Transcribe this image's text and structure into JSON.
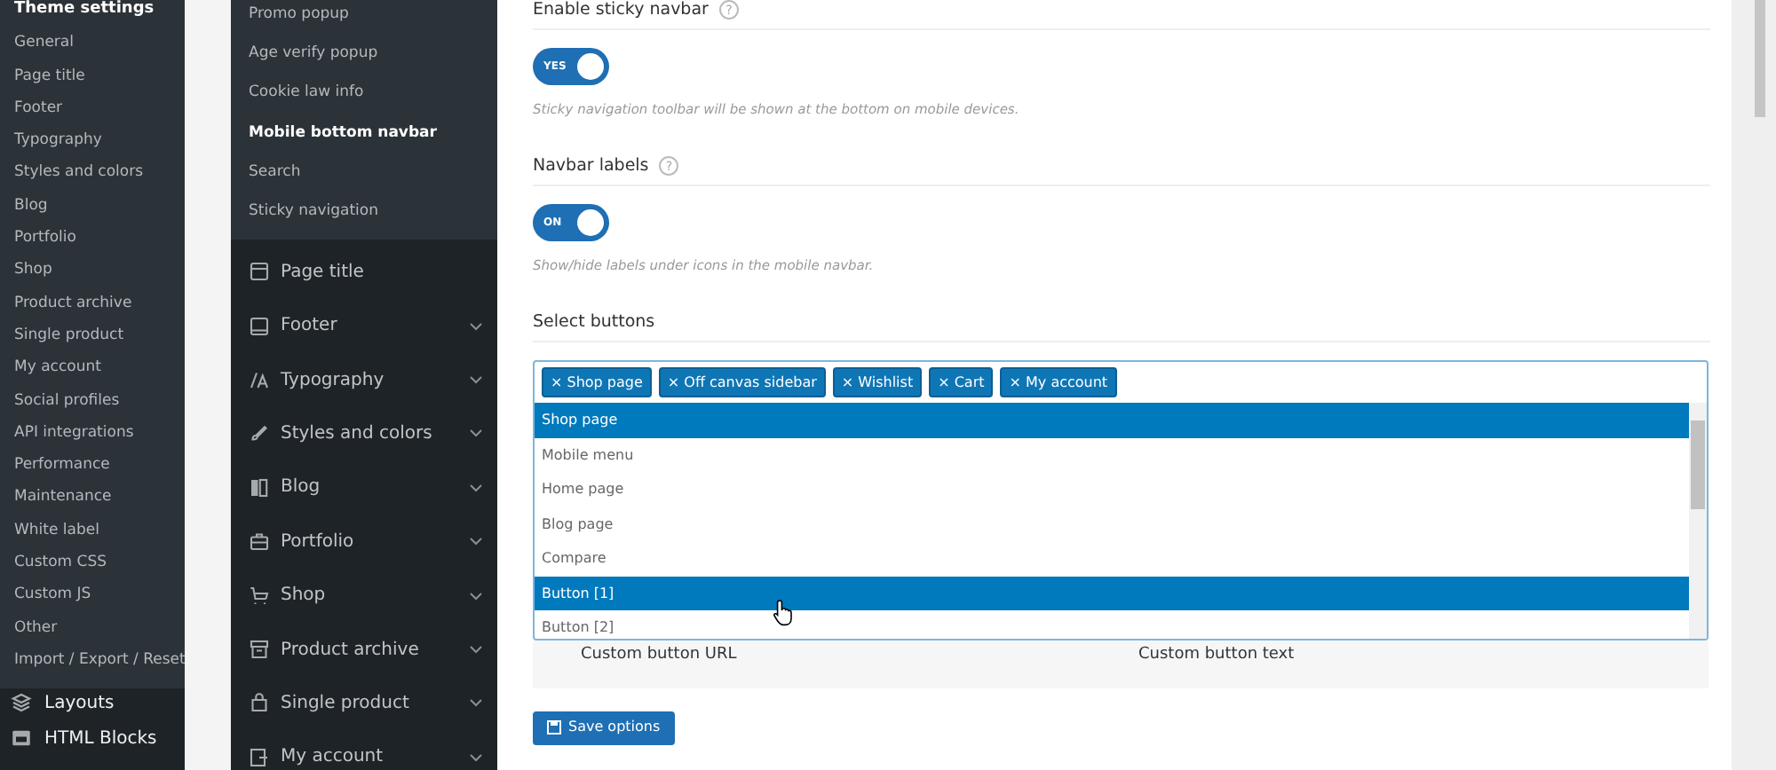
{
  "admin_menu": {
    "heading": "Theme settings",
    "items": [
      {
        "label": "General"
      },
      {
        "label": "Page title"
      },
      {
        "label": "Footer"
      },
      {
        "label": "Typography"
      },
      {
        "label": "Styles and colors"
      },
      {
        "label": "Blog"
      },
      {
        "label": "Portfolio"
      },
      {
        "label": "Shop"
      },
      {
        "label": "Product archive"
      },
      {
        "label": "Single product"
      },
      {
        "label": "My account"
      },
      {
        "label": "Social profiles"
      },
      {
        "label": "API integrations"
      },
      {
        "label": "Performance"
      },
      {
        "label": "Maintenance"
      },
      {
        "label": "White label"
      },
      {
        "label": "Custom CSS"
      },
      {
        "label": "Custom JS"
      },
      {
        "label": "Other"
      },
      {
        "label": "Import / Export / Reset"
      }
    ],
    "sections": [
      {
        "label": "Layouts"
      },
      {
        "label": "HTML Blocks"
      }
    ]
  },
  "options_nav": {
    "subitems": [
      {
        "label": "Promo popup",
        "selected": false
      },
      {
        "label": "Age verify popup",
        "selected": false
      },
      {
        "label": "Cookie law info",
        "selected": false
      },
      {
        "label": "Mobile bottom navbar",
        "selected": true
      },
      {
        "label": "Search",
        "selected": false
      },
      {
        "label": "Sticky navigation",
        "selected": false
      }
    ],
    "items": [
      {
        "label": "Page title",
        "expandable": false
      },
      {
        "label": "Footer",
        "expandable": true
      },
      {
        "label": "Typography",
        "expandable": true
      },
      {
        "label": "Styles and colors",
        "expandable": true
      },
      {
        "label": "Blog",
        "expandable": true
      },
      {
        "label": "Portfolio",
        "expandable": true
      },
      {
        "label": "Shop",
        "expandable": true
      },
      {
        "label": "Product archive",
        "expandable": true
      },
      {
        "label": "Single product",
        "expandable": true
      },
      {
        "label": "My account",
        "expandable": true
      }
    ]
  },
  "settings": [
    {
      "kind": "toggle",
      "label": "Enable sticky navbar",
      "help": "?",
      "on": true,
      "switch_text": "YES",
      "description": "Sticky navigation toolbar will be shown at the bottom on mobile devices."
    },
    {
      "kind": "toggle",
      "label": "Navbar labels",
      "help": "?",
      "on": true,
      "switch_text": "ON",
      "description": "Show/hide labels under icons in the mobile navbar."
    },
    {
      "kind": "multiselect",
      "label": "Select buttons",
      "tags": [
        {
          "remove": "×",
          "label": "Shop page"
        },
        {
          "remove": "×",
          "label": "Off canvas sidebar"
        },
        {
          "remove": "×",
          "label": "Wishlist"
        },
        {
          "remove": "×",
          "label": "Cart"
        },
        {
          "remove": "×",
          "label": "My account"
        }
      ],
      "options": [
        {
          "label": "Shop page",
          "selected": true
        },
        {
          "label": "Mobile menu",
          "selected": false
        },
        {
          "label": "Home page",
          "selected": false
        },
        {
          "label": "Blog page",
          "selected": false
        },
        {
          "label": "Compare",
          "selected": false
        },
        {
          "label": "Button [1]",
          "selected": true
        },
        {
          "label": "Button [2]",
          "selected": false
        }
      ]
    }
  ],
  "custom_fields": {
    "columns": [
      "Custom button URL",
      "Custom button text"
    ]
  },
  "save_button": "Save options"
}
